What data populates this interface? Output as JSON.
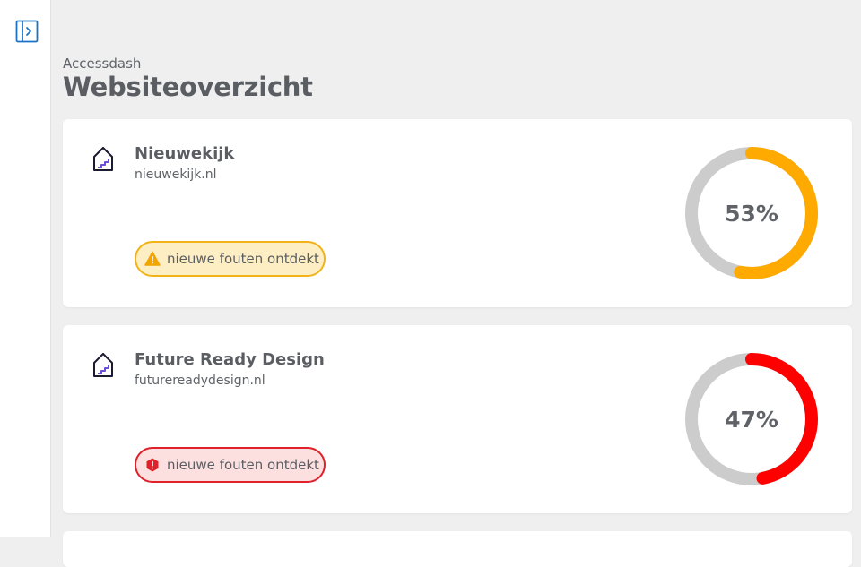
{
  "sidebar": {
    "toggle_icon": "sidebar-expand-icon",
    "accent_color": "#1a73c8"
  },
  "header": {
    "app_name": "Accessdash",
    "title": "Websiteoverzicht"
  },
  "sites": [
    {
      "name": "Nieuwekijk",
      "url": "nieuwekijk.nl",
      "logo_icon": "house-stairs-icon",
      "status": {
        "label": "nieuwe fouten ontdekt",
        "type": "warning",
        "icon": "warning-triangle-icon",
        "color": "#f2b318"
      },
      "score": {
        "value": 53,
        "label": "53%",
        "color": "#ffaa00",
        "track_color": "#cccccc"
      }
    },
    {
      "name": "Future Ready Design",
      "url": "futurereadydesign.nl",
      "logo_icon": "house-stairs-icon",
      "status": {
        "label": "nieuwe fouten ontdekt",
        "type": "error",
        "icon": "error-octagon-icon",
        "color": "#e0202a"
      },
      "score": {
        "value": 47,
        "label": "47%",
        "color": "#ff0000",
        "track_color": "#cccccc"
      }
    }
  ]
}
